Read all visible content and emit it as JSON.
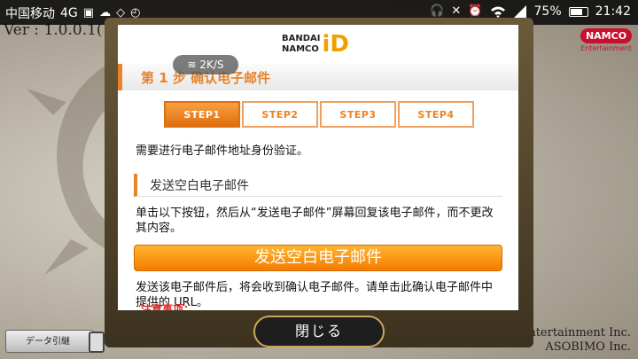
{
  "status_bar": {
    "carrier": "中国移动",
    "network": "4G",
    "battery": "75%",
    "battery_level": 0.75,
    "time": "21:42",
    "icons": [
      "headphones-icon",
      "mute-icon",
      "alarm-icon",
      "wifi-icon",
      "signal-icon",
      "battery-icon"
    ]
  },
  "background": {
    "version": "Ver : 1.0.0.1(",
    "namco_logo": "NAMCO",
    "namco_sub": "Entertainment",
    "copyright_line1": "Entertainment Inc.",
    "copyright_line2": "ASOBIMO Inc.",
    "data_sync_label": "データ引継"
  },
  "dialog": {
    "brand_line1": "BANDAI",
    "brand_line2": "NAMCO",
    "brand_id": "iD",
    "step_title": "第 1 步 确认电子邮件",
    "network_speed": "2K/S",
    "steps": [
      "STEP1",
      "STEP2",
      "STEP3",
      "STEP4"
    ],
    "active_step": 1,
    "intro_text": "需要进行电子邮件地址身份验证。",
    "section_title": "发送空白电子邮件",
    "instruction": "单击以下按钮，然后从“发送电子邮件”屏幕回复该电子邮件，而不更改其内容。",
    "send_button": "发送空白电子邮件",
    "after_send_text": "发送该电子邮件后，将会收到确认电子邮件。请单击此确认电子邮件中提供的 URL。",
    "warning_partial": "注意事项："
  },
  "close_button": "閉じる",
  "colors": {
    "accent": "#e8832a",
    "button_orange": "#f57c00",
    "frame_gold": "#c9a85a"
  }
}
